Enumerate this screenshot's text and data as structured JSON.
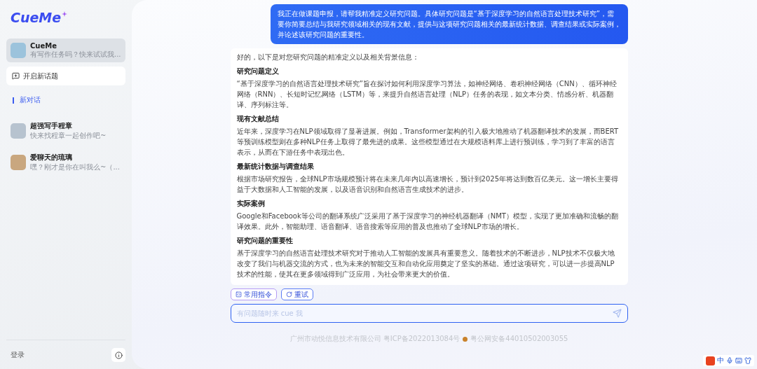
{
  "sidebar": {
    "logo": "CueMe",
    "assistants": [
      {
        "name": "CueMe",
        "preview": "有写作任务吗？快来试试我...",
        "selected": true
      },
      {
        "name": "超强写手程章",
        "preview": "快来找程章一起创作吧~",
        "selected": false
      },
      {
        "name": "爱聊天的琉璃",
        "preview": "嘿？刚才是你在叫我么~（...",
        "selected": false
      }
    ],
    "new_topic_button": "开启新话题",
    "conversations": [
      {
        "title": "新对话",
        "selected": true
      }
    ],
    "login": "登录"
  },
  "chat": {
    "user_message": "我正在做课题申报，请帮我精准定义研究问题。具体研究问题是“基于深度学习的自然语言处理技术研究”，需要你简要总结与我研究领域相关的现有文献，提供与这项研究问题相关的最新统计数据、调查结果或实际案例，并论述该研究问题的重要性。",
    "answer": [
      {
        "kind": "paragraph",
        "text": "好的，以下是对您研究问题的精准定义以及相关背景信息："
      },
      {
        "kind": "heading",
        "text": "研究问题定义"
      },
      {
        "kind": "paragraph",
        "text": "“基于深度学习的自然语言处理技术研究”旨在探讨如何利用深度学习算法，如神经网络、卷积神经网络（CNN）、循环神经网络（RNN）、长短时记忆网络（LSTM）等，来提升自然语言处理（NLP）任务的表现，如文本分类、情感分析、机器翻译、序列标注等。"
      },
      {
        "kind": "heading",
        "text": "现有文献总结"
      },
      {
        "kind": "paragraph",
        "text": "近年来，深度学习在NLP领域取得了显著进展。例如，Transformer架构的引入极大地推动了机器翻译技术的发展，而BERT等预训练模型则在多种NLP任务上取得了最先进的成果。这些模型通过在大规模语料库上进行预训练，学习到了丰富的语言表示，从而在下游任务中表现出色。"
      },
      {
        "kind": "heading",
        "text": "最新统计数据与调查结果"
      },
      {
        "kind": "paragraph",
        "text": "根据市场研究报告，全球NLP市场规模预计将在未来几年内以高速增长，预计到2025年将达到数百亿美元。这一增长主要得益于大数据和人工智能的发展，以及语音识别和自然语言生成技术的进步。"
      },
      {
        "kind": "heading",
        "text": "实际案例"
      },
      {
        "kind": "paragraph",
        "text": "Google和Facebook等公司的翻译系统广泛采用了基于深度学习的神经机器翻译（NMT）模型，实现了更加准确和流畅的翻译效果。此外，智能助理、语音翻译、语音搜索等应用的普及也推动了全球NLP市场的增长。"
      },
      {
        "kind": "heading",
        "text": "研究问题的重要性"
      },
      {
        "kind": "paragraph",
        "text": "基于深度学习的自然语言处理技术研究对于推动人工智能的发展具有重要意义。随着技术的不断进步，NLP技术不仅极大地改变了我们与机器交流的方式，也为未来的智能交互和自动化应用奠定了坚实的基础。通过这项研究，可以进一步提高NLP技术的性能，使其在更多领域得到广泛应用，为社会带来更大的价值。"
      }
    ],
    "actions": [
      {
        "kind": "commands",
        "label": "常用指令"
      },
      {
        "kind": "retry",
        "label": "重试"
      }
    ],
    "input": {
      "placeholder": "有问题随时来 cue 我"
    },
    "footer": {
      "company": "广州市动悦信息技术有限公司 粤ICP备2022013084号",
      "police": "粤公网安备44010502003055"
    }
  },
  "ime_toolbar": {
    "language": "中"
  }
}
